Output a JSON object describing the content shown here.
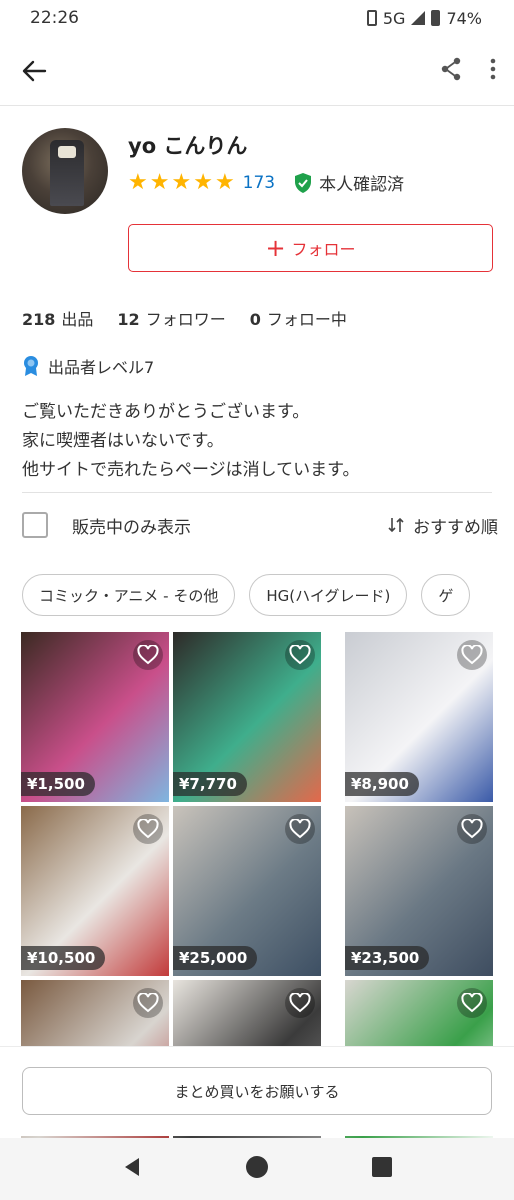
{
  "status": {
    "time": "22:26",
    "network": "5G",
    "battery": "74%"
  },
  "appbar": {
    "back_icon": "back-arrow-icon",
    "share_icon": "share-icon",
    "more_icon": "more-vert-icon"
  },
  "profile": {
    "name": "yo こんりん",
    "rating_stars": 5,
    "rating_count": "173",
    "verified_label": "本人確認済",
    "follow_label": "フォロー",
    "stats": {
      "listings_count": "218",
      "listings_label": "出品",
      "followers_count": "12",
      "followers_label": "フォロワー",
      "following_count": "0",
      "following_label": "フォロー中"
    },
    "level_label": "出品者レベル7",
    "bio": [
      "ご覧いただきありがとうございます。",
      "家に喫煙者はいないです。",
      "他サイトで売れたらページは消しています。"
    ]
  },
  "filter": {
    "on_sale_only_label": "販売中のみ表示",
    "sort_label": "おすすめ順"
  },
  "chips": [
    "コミック・アニメ - その他",
    "HG(ハイグレード)",
    "ゲ"
  ],
  "items": [
    {
      "price": "¥1,500",
      "colors": [
        "#3b2a22",
        "#c94f8a",
        "#7fb6e0"
      ]
    },
    {
      "price": "¥7,770",
      "colors": [
        "#2e2a28",
        "#3fae8c",
        "#e4684b"
      ]
    },
    {
      "price": "¥8,900",
      "colors": [
        "#c9ccd2",
        "#f4f4f6",
        "#3a5aa8"
      ]
    },
    {
      "price": "¥10,500",
      "colors": [
        "#8a6a4a",
        "#e9e6e2",
        "#c23a3a"
      ]
    },
    {
      "price": "¥25,000",
      "colors": [
        "#c9c3bb",
        "#6c7b86",
        "#3d4f63"
      ]
    },
    {
      "price": "¥23,500",
      "colors": [
        "#c8c2ba",
        "#6a7884",
        "#3e4d60"
      ]
    },
    {
      "price": "",
      "colors": [
        "#7a5a40",
        "#d8d4cf",
        "#a83030"
      ]
    },
    {
      "price": "",
      "colors": [
        "#e8e4de",
        "#3b3b3b",
        "#8a8a8a"
      ]
    },
    {
      "price": "",
      "colors": [
        "#d8d6d0",
        "#3aa04a",
        "#ffffff"
      ]
    }
  ],
  "bulk_button_label": "まとめ買いをお願いする",
  "nav": {
    "back": "nav-back-icon",
    "home": "nav-home-icon",
    "recents": "nav-recents-icon"
  }
}
